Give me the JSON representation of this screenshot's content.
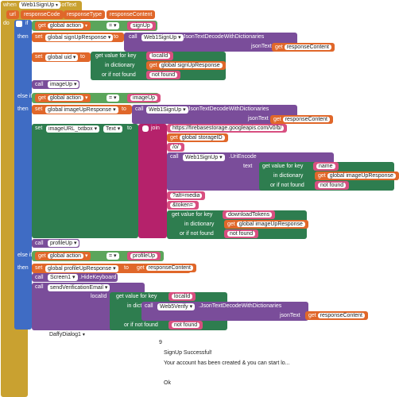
{
  "event": {
    "when": "when",
    "component": "Web1SignUp",
    "event_name": "GotText",
    "params": [
      "url",
      "responseCode",
      "responseType",
      "responseContent"
    ],
    "do": "do"
  },
  "if_block": {
    "if_label": "if",
    "else_if_label": "else if",
    "then_label": "then",
    "set_label": "set",
    "to_label": "to",
    "call_label": "call",
    "get_label": "get",
    "get_value_for_key": "get value for key",
    "in_dictionary": "in dictionary",
    "or_if_not_found": "or if not found",
    "json_text": "jsonText",
    "eq": "=",
    "join": "join",
    "text_label": "text"
  },
  "branch1": {
    "cond_var": "global action",
    "cond_val": "signUp",
    "set1_var": "global signUpResponse",
    "set1_component": "Web1SignUp",
    "set1_method": ".JsonTextDecodeWithDictionaries",
    "set1_arg": "responseContent",
    "set2_var": "global uid",
    "set2_key": "localId",
    "set2_dict": "global signUpResponse",
    "set2_notfound": "not found",
    "call": "imageUp"
  },
  "branch2": {
    "cond_var": "global action",
    "cond_val": "imageUp",
    "set1_var": "global imageUpResponse",
    "set1_component": "Web1SignUp",
    "set1_method": ".JsonTextDecodeWithDictionaries",
    "set1_arg": "responseContent",
    "set2_component": "imageURL_txtbox",
    "set2_prop": "Text",
    "join_items": [
      "https://firebasestorage.googleapis.com/v0/b/",
      "global storageID",
      "/o/",
      "?alt=media",
      "&token="
    ],
    "uri_component": "Web1SignUp",
    "uri_method": ".UriEncode",
    "uri_key": "name",
    "uri_dict": "global imageUpResponse",
    "uri_notfound": "not found",
    "tok_key": "downloadTokens",
    "tok_dict": "global imageUpResponse",
    "tok_notfound": "not found",
    "call": "profileUp"
  },
  "branch3": {
    "cond_var": "global action",
    "cond_val": "profileUp",
    "set1_var": "global profileUpResponse",
    "set1_arg": "responseContent",
    "call1_component": "Screen1",
    "call1_method": ".HideKeyboard",
    "call2_proc": "sendVerificationEmail",
    "call2_param": "localId",
    "call2_key": "localId",
    "call2_component": "Web5Verify",
    "call2_method": ".JsonTextDecodeWithDictionaries",
    "call2_arg": "responseContent",
    "call2_notfound": "not found"
  },
  "dialog": {
    "component": "DaffyDialog1",
    "number": "9",
    "title": "SignUp Successful!",
    "message": "Your account has been created & you can start lo...",
    "button": "Ok"
  }
}
